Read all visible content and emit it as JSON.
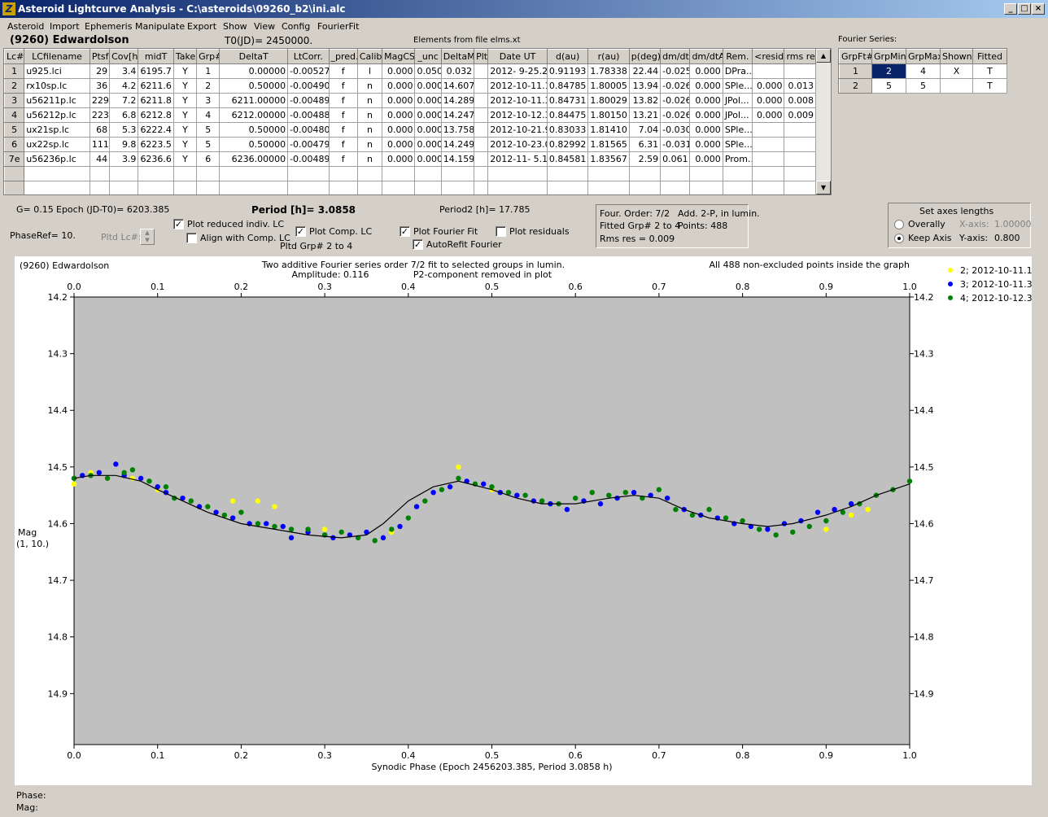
{
  "window": {
    "title": "Asteroid Lightcurve Analysis - C:\\asteroids\\09260_b2\\ini.alc",
    "minimize": "_",
    "maximize": "□",
    "close": "×"
  },
  "menu": [
    "Asteroid",
    "Import",
    "Ephemeris",
    "Manipulate",
    "Export",
    "Show",
    "View",
    "Config",
    "FourierFit"
  ],
  "header": {
    "object_name": "(9260) Edwardolson",
    "t0": "T0(JD)= 2450000.",
    "elements": "Elements from file elms.xt",
    "fourier_label": "Fourier Series:"
  },
  "lc_table": {
    "columns": [
      "Lc#",
      "LCfilename",
      "Ptsf",
      "Cov[h]",
      "midT",
      "Take",
      "Grp#",
      "DeltaT",
      "LtCorr.",
      "_pred.",
      "Calib.",
      "MagCS",
      "_unc",
      "DeltaM",
      "Plt",
      "Date UT",
      "d(au)",
      "r(au)",
      "p(deg)",
      "dm/dt",
      "dm/dtA",
      "Rem.",
      "<resid>",
      "rms res"
    ],
    "rows": [
      [
        "1",
        "u925.lci",
        "29",
        "3.4",
        "6195.7",
        "Y",
        "1",
        "0.00000",
        "-0.00527",
        "f",
        "l",
        "0.000",
        "0.050",
        "0.032",
        "",
        "2012- 9-25.2",
        "0.91193",
        "1.78338",
        "22.44",
        "-0.025",
        "0.000",
        "DPra...",
        "",
        ""
      ],
      [
        "2",
        "rx10sp.lc",
        "36",
        "4.2",
        "6211.6",
        "Y",
        "2",
        "0.50000",
        "-0.00490",
        "f",
        "n",
        "0.000",
        "0.000",
        "14.607",
        "",
        "2012-10-11.1",
        "0.84785",
        "1.80005",
        "13.94",
        "-0.026",
        "0.000",
        "SPle...",
        "0.000",
        "0.013"
      ],
      [
        "3",
        "u56211p.lc",
        "229",
        "7.2",
        "6211.8",
        "Y",
        "3",
        "6211.00000",
        "-0.00489",
        "f",
        "n",
        "0.000",
        "0.000",
        "14.289",
        "",
        "2012-10-11.3",
        "0.84731",
        "1.80029",
        "13.82",
        "-0.026",
        "0.000",
        "JPol...",
        "0.000",
        "0.008"
      ],
      [
        "4",
        "u56212p.lc",
        "223",
        "6.8",
        "6212.8",
        "Y",
        "4",
        "6212.00000",
        "-0.00488",
        "f",
        "n",
        "0.000",
        "0.000",
        "14.247",
        "",
        "2012-10-12.3",
        "0.84475",
        "1.80150",
        "13.21",
        "-0.026",
        "0.000",
        "JPol...",
        "0.000",
        "0.009"
      ],
      [
        "5",
        "ux21sp.lc",
        "68",
        "5.3",
        "6222.4",
        "Y",
        "5",
        "0.50000",
        "-0.00480",
        "f",
        "n",
        "0.000",
        "0.000",
        "13.758",
        "",
        "2012-10-21.9",
        "0.83033",
        "1.81410",
        "7.04",
        "-0.030",
        "0.000",
        "SPle...",
        "",
        ""
      ],
      [
        "6",
        "ux22sp.lc",
        "111",
        "9.8",
        "6223.5",
        "Y",
        "5",
        "0.50000",
        "-0.00479",
        "f",
        "n",
        "0.000",
        "0.000",
        "14.249",
        "",
        "2012-10-23.0",
        "0.82992",
        "1.81565",
        "6.31",
        "-0.031",
        "0.000",
        "SPle...",
        "",
        ""
      ],
      [
        "7e",
        "u56236p.lc",
        "44",
        "3.9",
        "6236.6",
        "Y",
        "6",
        "6236.00000",
        "-0.00489",
        "f",
        "n",
        "0.000",
        "0.000",
        "14.159",
        "",
        "2012-11- 5.1",
        "0.84581",
        "1.83567",
        "2.59",
        "0.061",
        "0.000",
        "Prom...",
        "",
        ""
      ]
    ]
  },
  "fourier_table": {
    "columns": [
      "GrpFt#",
      "GrpMin",
      "GrpMax",
      "Shown",
      "Fitted"
    ],
    "rows": [
      [
        "1",
        "2",
        "4",
        "X",
        "T"
      ],
      [
        "2",
        "5",
        "5",
        "",
        "T"
      ]
    ]
  },
  "controls": {
    "g": "G= 0.15",
    "epoch": "Epoch (JD-T0)= 6203.385",
    "period": "Period [h]= 3.0858",
    "period2": "Period2 [h]= 17.785",
    "phase_ref": "PhaseRef= 10.",
    "pltd_lc": "Pltd Lc#:",
    "plot_reduced": "Plot reduced indiv. LC",
    "align_comp": "Align with Comp. LC",
    "plot_comp": "Plot Comp. LC",
    "pltd_grp": "Pltd Grp#  2   to   4",
    "plot_fourier": "Plot Fourier Fit",
    "autorefit": "AutoRefit Fourier",
    "plot_residuals": "Plot residuals",
    "info_order": "Four. Order:  7/2",
    "info_add": "Add. 2-P, in lumin.",
    "info_fitted": "Fitted Grp# 2 to 4",
    "info_points": "Points: 488",
    "info_rms": "Rms res     = 0.009",
    "axes_title": "Set axes lengths",
    "overall": "Overally",
    "keep_axis": "Keep Axis",
    "xaxis_label": "X-axis:",
    "xaxis_val": "1.00000",
    "yaxis_label": "Y-axis:",
    "yaxis_val": "0.800",
    "check": "✓"
  },
  "chart_data": {
    "type": "scatter",
    "object": "(9260) Edwardolson",
    "note1": "Two additive Fourier series order 7/2 fit to selected groups in lumin.",
    "note2": "Amplitude: 0.116",
    "note3": "P2-component removed in plot",
    "note4": "All 488 non-excluded points inside the graph",
    "xlabel": "Synodic Phase (Epoch 2456203.385, Period 3.0858 h)",
    "ylabel": "Mag",
    "ylabel2": "(1, 10.)",
    "xlim": [
      0.0,
      1.0
    ],
    "ylim": [
      14.2,
      14.99
    ],
    "y_inverted": true,
    "xticks": [
      "0.0",
      "0.1",
      "0.2",
      "0.3",
      "0.4",
      "0.5",
      "0.6",
      "0.7",
      "0.8",
      "0.9",
      "1.0"
    ],
    "yticks": [
      "14.2",
      "14.3",
      "14.4",
      "14.5",
      "14.6",
      "14.7",
      "14.8",
      "14.9"
    ],
    "fit_curve": {
      "x": [
        0.0,
        0.02,
        0.05,
        0.08,
        0.1,
        0.13,
        0.16,
        0.2,
        0.24,
        0.28,
        0.32,
        0.35,
        0.37,
        0.4,
        0.43,
        0.46,
        0.5,
        0.53,
        0.56,
        0.6,
        0.64,
        0.67,
        0.7,
        0.73,
        0.76,
        0.8,
        0.83,
        0.86,
        0.9,
        0.93,
        0.96,
        1.0
      ],
      "y": [
        14.52,
        14.515,
        14.515,
        14.525,
        14.54,
        14.56,
        14.58,
        14.6,
        14.61,
        14.62,
        14.625,
        14.62,
        14.6,
        14.56,
        14.535,
        14.525,
        14.54,
        14.555,
        14.565,
        14.565,
        14.555,
        14.55,
        14.555,
        14.575,
        14.59,
        14.6,
        14.605,
        14.6,
        14.585,
        14.57,
        14.55,
        14.53
      ]
    },
    "series": [
      {
        "name": "2; 2012-10-11.1",
        "color": "#ffff00",
        "x": [
          0.0,
          0.02,
          0.07,
          0.1,
          0.13,
          0.17,
          0.19,
          0.22,
          0.24,
          0.3,
          0.38,
          0.46,
          0.5,
          0.55,
          0.9,
          0.93,
          0.95
        ],
        "y": [
          14.53,
          14.51,
          14.52,
          14.54,
          14.555,
          14.58,
          14.56,
          14.56,
          14.57,
          14.61,
          14.615,
          14.5,
          14.54,
          14.56,
          14.61,
          14.585,
          14.575
        ]
      },
      {
        "name": "3; 2012-10-11.3",
        "color": "#0000ff",
        "x": [
          0.0,
          0.01,
          0.03,
          0.05,
          0.06,
          0.08,
          0.1,
          0.11,
          0.13,
          0.15,
          0.17,
          0.19,
          0.21,
          0.23,
          0.25,
          0.26,
          0.28,
          0.3,
          0.31,
          0.33,
          0.35,
          0.37,
          0.39,
          0.41,
          0.43,
          0.45,
          0.47,
          0.49,
          0.51,
          0.53,
          0.55,
          0.57,
          0.59,
          0.61,
          0.63,
          0.65,
          0.67,
          0.69,
          0.71,
          0.73,
          0.75,
          0.77,
          0.79,
          0.81,
          0.83,
          0.85,
          0.87,
          0.89,
          0.91,
          0.93
        ],
        "y": [
          14.52,
          14.515,
          14.51,
          14.495,
          14.515,
          14.52,
          14.535,
          14.545,
          14.555,
          14.57,
          14.58,
          14.59,
          14.6,
          14.6,
          14.605,
          14.625,
          14.615,
          14.62,
          14.625,
          14.62,
          14.615,
          14.625,
          14.605,
          14.57,
          14.545,
          14.535,
          14.525,
          14.53,
          14.545,
          14.55,
          14.56,
          14.565,
          14.575,
          14.56,
          14.565,
          14.555,
          14.545,
          14.55,
          14.555,
          14.575,
          14.585,
          14.59,
          14.6,
          14.605,
          14.61,
          14.6,
          14.595,
          14.58,
          14.575,
          14.565
        ]
      },
      {
        "name": "4; 2012-10-12.3",
        "color": "#008000",
        "x": [
          0.0,
          0.02,
          0.04,
          0.06,
          0.07,
          0.09,
          0.11,
          0.12,
          0.14,
          0.16,
          0.18,
          0.2,
          0.22,
          0.24,
          0.26,
          0.28,
          0.3,
          0.32,
          0.34,
          0.36,
          0.38,
          0.4,
          0.42,
          0.44,
          0.46,
          0.48,
          0.5,
          0.52,
          0.54,
          0.56,
          0.58,
          0.6,
          0.62,
          0.64,
          0.66,
          0.68,
          0.7,
          0.72,
          0.74,
          0.76,
          0.78,
          0.8,
          0.82,
          0.84,
          0.86,
          0.88,
          0.9,
          0.92,
          0.94,
          0.96,
          0.98,
          1.0
        ],
        "y": [
          14.52,
          14.515,
          14.52,
          14.51,
          14.505,
          14.525,
          14.535,
          14.555,
          14.56,
          14.57,
          14.585,
          14.58,
          14.6,
          14.605,
          14.61,
          14.61,
          14.62,
          14.615,
          14.625,
          14.63,
          14.61,
          14.59,
          14.56,
          14.54,
          14.52,
          14.53,
          14.535,
          14.545,
          14.55,
          14.56,
          14.565,
          14.555,
          14.545,
          14.55,
          14.545,
          14.555,
          14.54,
          14.575,
          14.585,
          14.575,
          14.59,
          14.595,
          14.61,
          14.62,
          14.615,
          14.605,
          14.595,
          14.58,
          14.565,
          14.55,
          14.54,
          14.525
        ]
      }
    ]
  },
  "status": {
    "phase": "Phase:",
    "mag": "Mag:"
  }
}
